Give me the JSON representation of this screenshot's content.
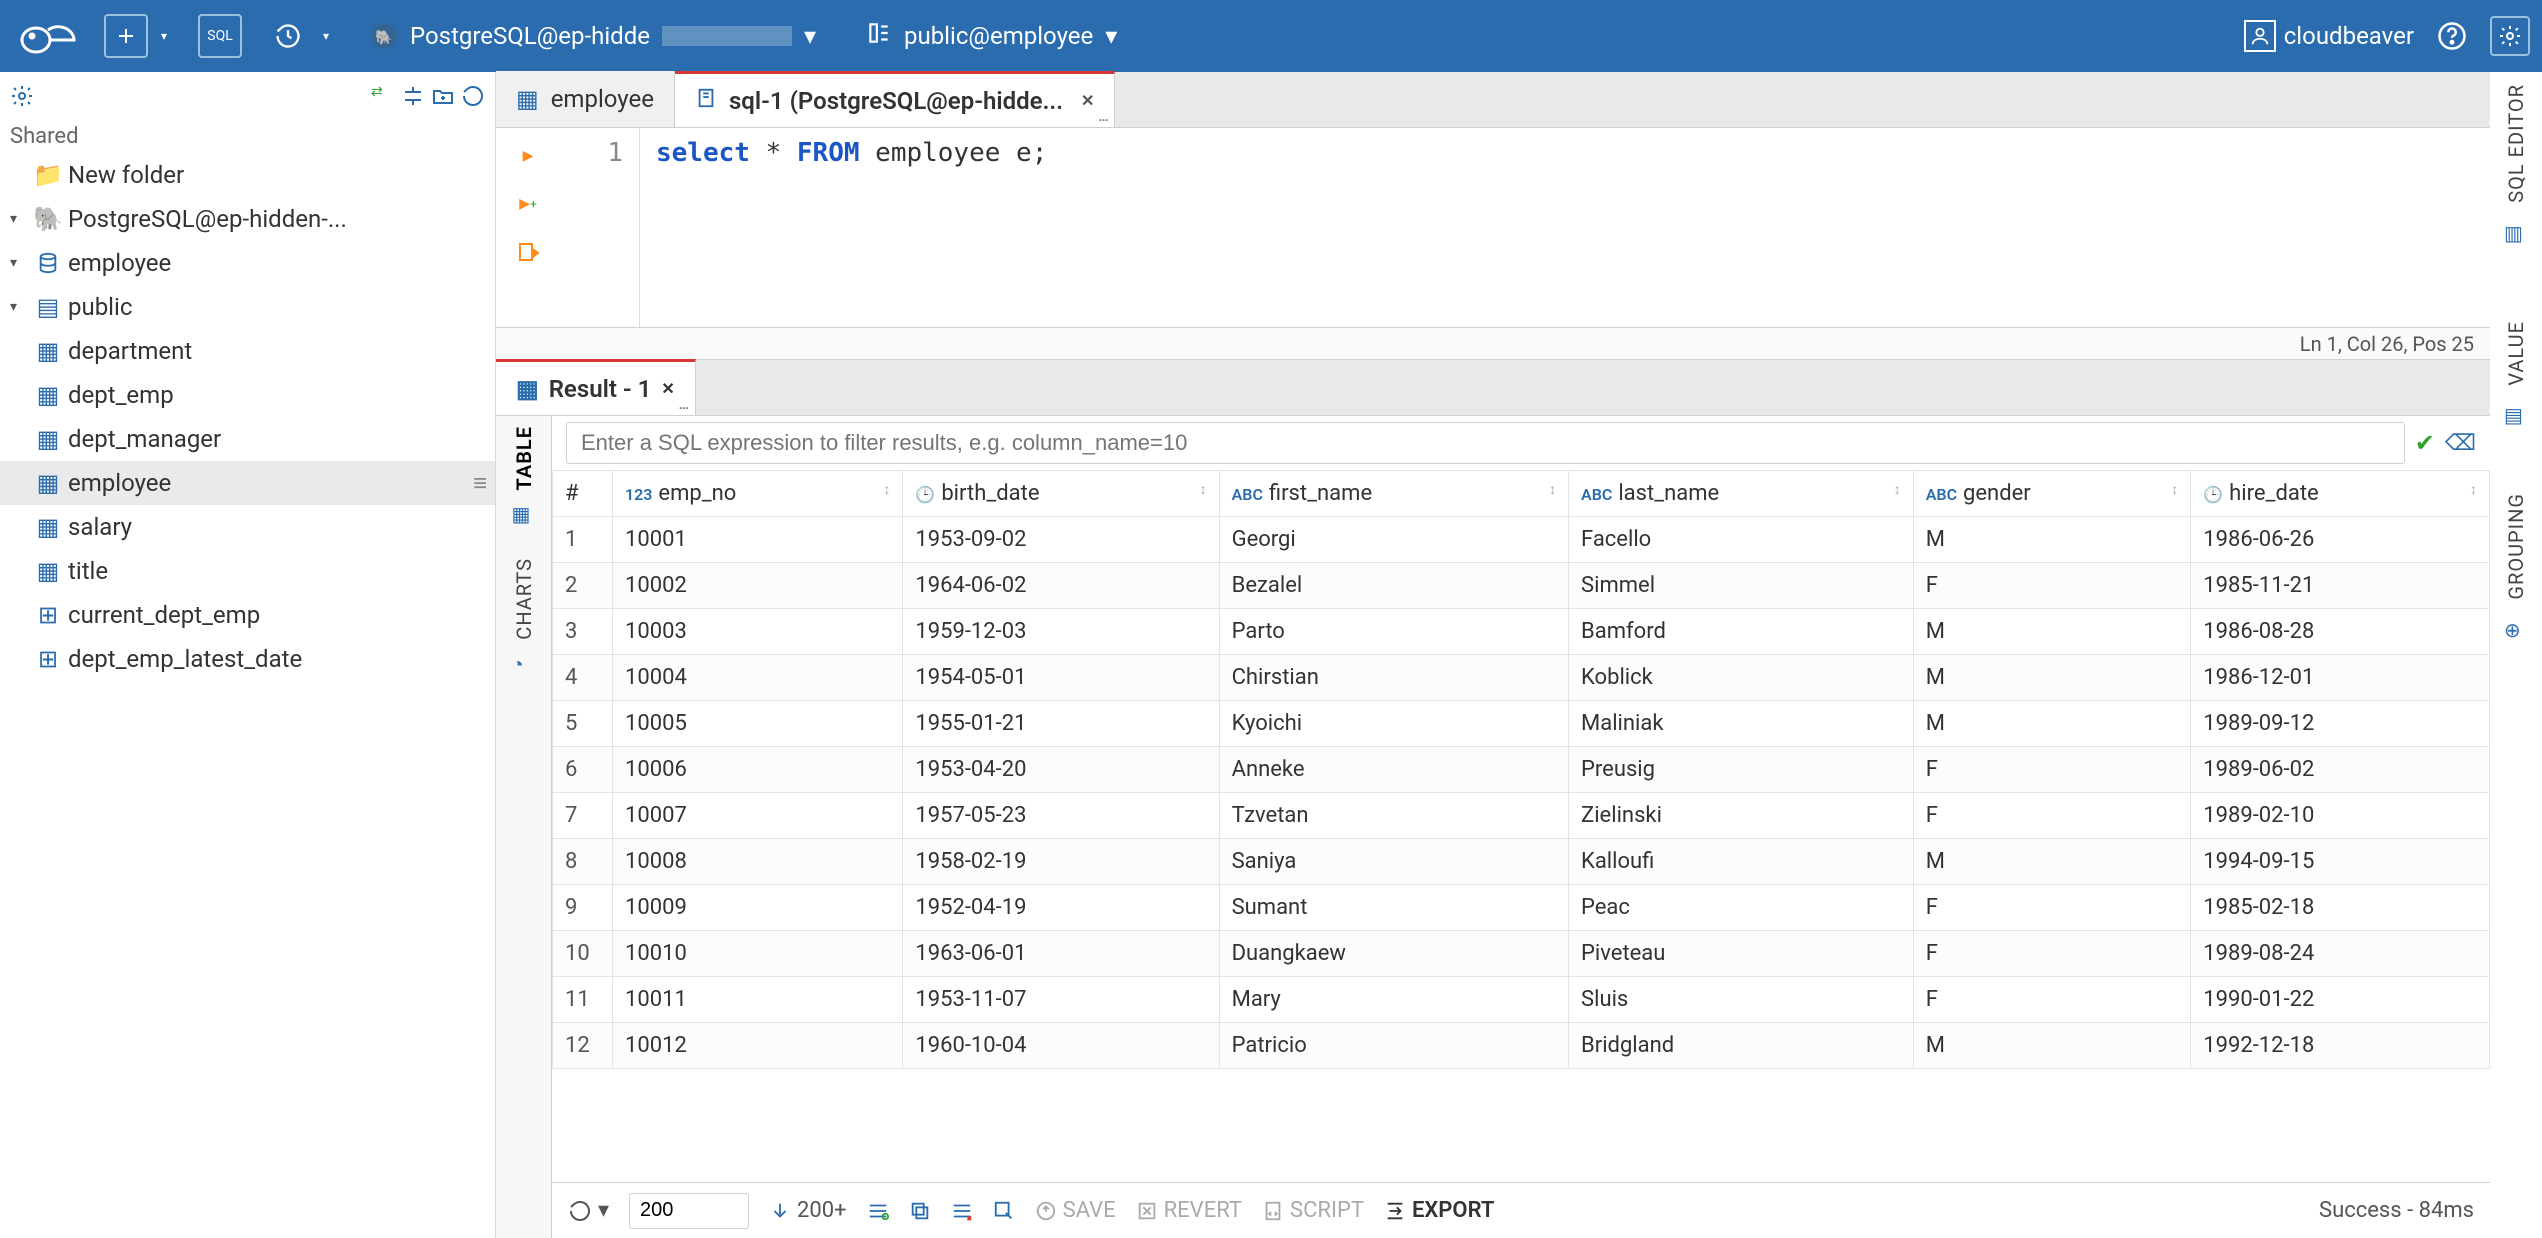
{
  "topbar": {
    "connection_label": "PostgreSQL@ep-hidde",
    "schema_label": "public@employee",
    "user": "cloudbeaver"
  },
  "nav": {
    "section": "Shared",
    "new_folder": "New folder",
    "connection": "PostgreSQL@ep-hidden-...",
    "database": "employee",
    "schema": "public",
    "tables": {
      "department": "department",
      "dept_emp": "dept_emp",
      "dept_manager": "dept_manager",
      "employee": "employee",
      "salary": "salary",
      "title": "title"
    },
    "views": {
      "current_dept_emp": "current_dept_emp",
      "dept_emp_latest_date": "dept_emp_latest_date"
    }
  },
  "tabs": {
    "employee": "employee",
    "sql": "sql-1 (PostgreSQL@ep-hidde..."
  },
  "editor": {
    "line_no": "1",
    "code_select": "select",
    "code_star": " * ",
    "code_from": "FROM",
    "code_rest": " employee e;",
    "status": "Ln 1, Col 26, Pos 25"
  },
  "result": {
    "tab_label": "Result - 1",
    "filter_placeholder": "Enter a SQL expression to filter results, e.g. column_name=10",
    "side": {
      "table": "TABLE",
      "charts": "CHARTS"
    },
    "columns": {
      "rownum": "#",
      "emp_no": "emp_no",
      "birth_date": "birth_date",
      "first_name": "first_name",
      "last_name": "last_name",
      "gender": "gender",
      "hire_date": "hire_date"
    },
    "col_types": {
      "emp_no": "123",
      "birth_date": "date",
      "first_name": "ABC",
      "last_name": "ABC",
      "gender": "ABC",
      "hire_date": "date"
    },
    "rows": [
      {
        "n": "1",
        "emp_no": "10001",
        "birth_date": "1953-09-02",
        "first_name": "Georgi",
        "last_name": "Facello",
        "gender": "M",
        "hire_date": "1986-06-26"
      },
      {
        "n": "2",
        "emp_no": "10002",
        "birth_date": "1964-06-02",
        "first_name": "Bezalel",
        "last_name": "Simmel",
        "gender": "F",
        "hire_date": "1985-11-21"
      },
      {
        "n": "3",
        "emp_no": "10003",
        "birth_date": "1959-12-03",
        "first_name": "Parto",
        "last_name": "Bamford",
        "gender": "M",
        "hire_date": "1986-08-28"
      },
      {
        "n": "4",
        "emp_no": "10004",
        "birth_date": "1954-05-01",
        "first_name": "Chirstian",
        "last_name": "Koblick",
        "gender": "M",
        "hire_date": "1986-12-01"
      },
      {
        "n": "5",
        "emp_no": "10005",
        "birth_date": "1955-01-21",
        "first_name": "Kyoichi",
        "last_name": "Maliniak",
        "gender": "M",
        "hire_date": "1989-09-12"
      },
      {
        "n": "6",
        "emp_no": "10006",
        "birth_date": "1953-04-20",
        "first_name": "Anneke",
        "last_name": "Preusig",
        "gender": "F",
        "hire_date": "1989-06-02"
      },
      {
        "n": "7",
        "emp_no": "10007",
        "birth_date": "1957-05-23",
        "first_name": "Tzvetan",
        "last_name": "Zielinski",
        "gender": "F",
        "hire_date": "1989-02-10"
      },
      {
        "n": "8",
        "emp_no": "10008",
        "birth_date": "1958-02-19",
        "first_name": "Saniya",
        "last_name": "Kalloufi",
        "gender": "M",
        "hire_date": "1994-09-15"
      },
      {
        "n": "9",
        "emp_no": "10009",
        "birth_date": "1952-04-19",
        "first_name": "Sumant",
        "last_name": "Peac",
        "gender": "F",
        "hire_date": "1985-02-18"
      },
      {
        "n": "10",
        "emp_no": "10010",
        "birth_date": "1963-06-01",
        "first_name": "Duangkaew",
        "last_name": "Piveteau",
        "gender": "F",
        "hire_date": "1989-08-24"
      },
      {
        "n": "11",
        "emp_no": "10011",
        "birth_date": "1953-11-07",
        "first_name": "Mary",
        "last_name": "Sluis",
        "gender": "F",
        "hire_date": "1990-01-22"
      },
      {
        "n": "12",
        "emp_no": "10012",
        "birth_date": "1960-10-04",
        "first_name": "Patricio",
        "last_name": "Bridgland",
        "gender": "M",
        "hire_date": "1992-12-18"
      }
    ]
  },
  "footer": {
    "limit": "200",
    "more": "200+",
    "save": "SAVE",
    "revert": "REVERT",
    "script": "SCRIPT",
    "export": "EXPORT",
    "status": "Success - 84ms"
  },
  "right": {
    "sql_editor": "SQL EDITOR",
    "value": "VALUE",
    "grouping": "GROUPING"
  }
}
